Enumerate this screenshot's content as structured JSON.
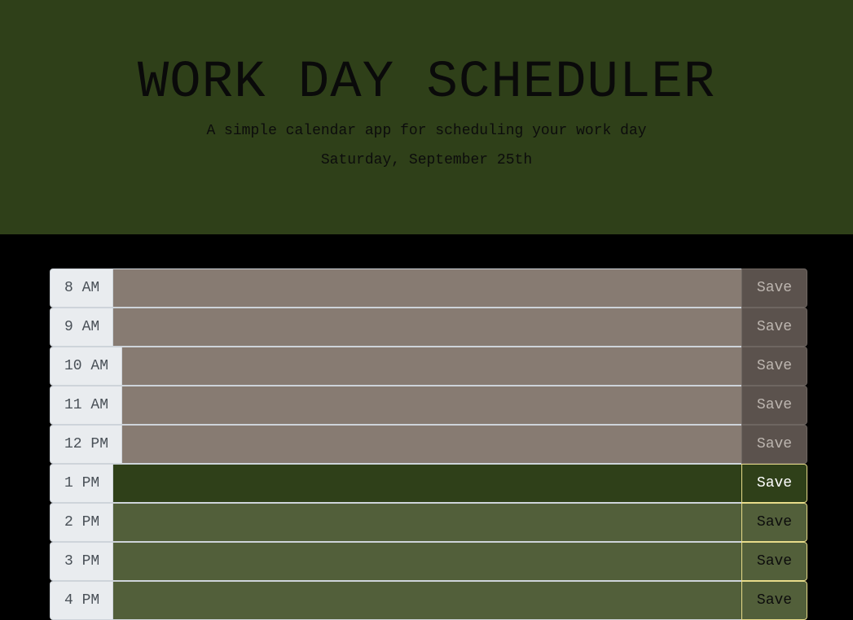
{
  "header": {
    "title": "WORK DAY SCHEDULER",
    "subtitle": "A simple calendar app for scheduling your work day",
    "date": "Saturday, September 25th"
  },
  "colors": {
    "header_bg": "#2f4019",
    "past": "#877b72",
    "present": "#2f4019",
    "future": "#525f3a"
  },
  "rows": [
    {
      "hour": "8 AM",
      "status": "past",
      "task": "",
      "save_label": "Save"
    },
    {
      "hour": "9 AM",
      "status": "past",
      "task": "",
      "save_label": "Save"
    },
    {
      "hour": "10 AM",
      "status": "past",
      "task": "",
      "save_label": "Save"
    },
    {
      "hour": "11 AM",
      "status": "past",
      "task": "",
      "save_label": "Save"
    },
    {
      "hour": "12 PM",
      "status": "past",
      "task": "",
      "save_label": "Save"
    },
    {
      "hour": "1 PM",
      "status": "present",
      "task": "",
      "save_label": "Save"
    },
    {
      "hour": "2 PM",
      "status": "future",
      "task": "",
      "save_label": "Save"
    },
    {
      "hour": "3 PM",
      "status": "future",
      "task": "",
      "save_label": "Save"
    },
    {
      "hour": "4 PM",
      "status": "future",
      "task": "",
      "save_label": "Save"
    }
  ]
}
